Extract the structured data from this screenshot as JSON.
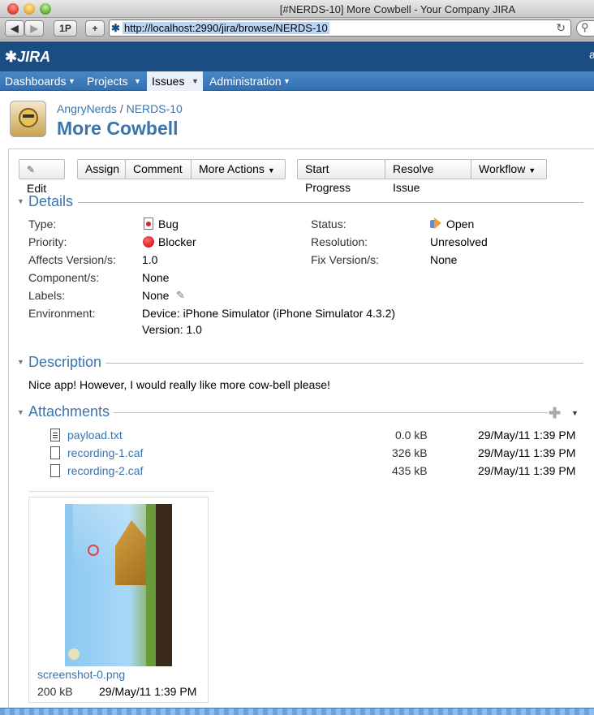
{
  "window": {
    "title": "[#NERDS-10] More Cowbell - Your Company JIRA"
  },
  "browser": {
    "back": "◀",
    "forward": "▶",
    "onep": "1P",
    "plus": "+",
    "url": "http://localhost:2990/jira/browse/NERDS-10",
    "reload": "↻"
  },
  "header": {
    "logo": "JIRA",
    "user_initial": "a"
  },
  "nav": [
    {
      "label": "Dashboards"
    },
    {
      "label": "Projects"
    },
    {
      "label": "Issues"
    },
    {
      "label": "Administration"
    }
  ],
  "breadcrumb": {
    "project": "AngryNerds",
    "sep": "/",
    "key": "NERDS-10"
  },
  "issue": {
    "title": "More Cowbell"
  },
  "actions": {
    "edit": "Edit",
    "assign": "Assign",
    "comment": "Comment",
    "more_actions": "More Actions",
    "start_progress": "Start Progress",
    "resolve_issue": "Resolve Issue",
    "workflow": "Workflow"
  },
  "details": {
    "heading": "Details",
    "type_label": "Type:",
    "type_value": "Bug",
    "priority_label": "Priority:",
    "priority_value": "Blocker",
    "affects_label": "Affects Version/s:",
    "affects_value": "1.0",
    "component_label": "Component/s:",
    "component_value": "None",
    "labels_label": "Labels:",
    "labels_value": "None",
    "environment_label": "Environment:",
    "environment_line1": "Device: iPhone Simulator (iPhone Simulator 4.3.2)",
    "environment_line2": "Version: 1.0",
    "status_label": "Status:",
    "status_value": "Open",
    "resolution_label": "Resolution:",
    "resolution_value": "Unresolved",
    "fix_label": "Fix Version/s:",
    "fix_value": "None"
  },
  "description": {
    "heading": "Description",
    "text": "Nice app! However, I would really like more cow-bell please!"
  },
  "attachments": {
    "heading": "Attachments",
    "files": [
      {
        "name": "payload.txt",
        "size": "0.0 kB",
        "date": "29/May/11 1:39 PM"
      },
      {
        "name": "recording-1.caf",
        "size": "326 kB",
        "date": "29/May/11 1:39 PM"
      },
      {
        "name": "recording-2.caf",
        "size": "435 kB",
        "date": "29/May/11 1:39 PM"
      }
    ],
    "image": {
      "name": "screenshot-0.png",
      "size": "200 kB",
      "date": "29/May/11 1:39 PM"
    }
  },
  "colors": {
    "header": "#1b4d82",
    "nav": "#3b78b8",
    "link": "#3b73af"
  }
}
